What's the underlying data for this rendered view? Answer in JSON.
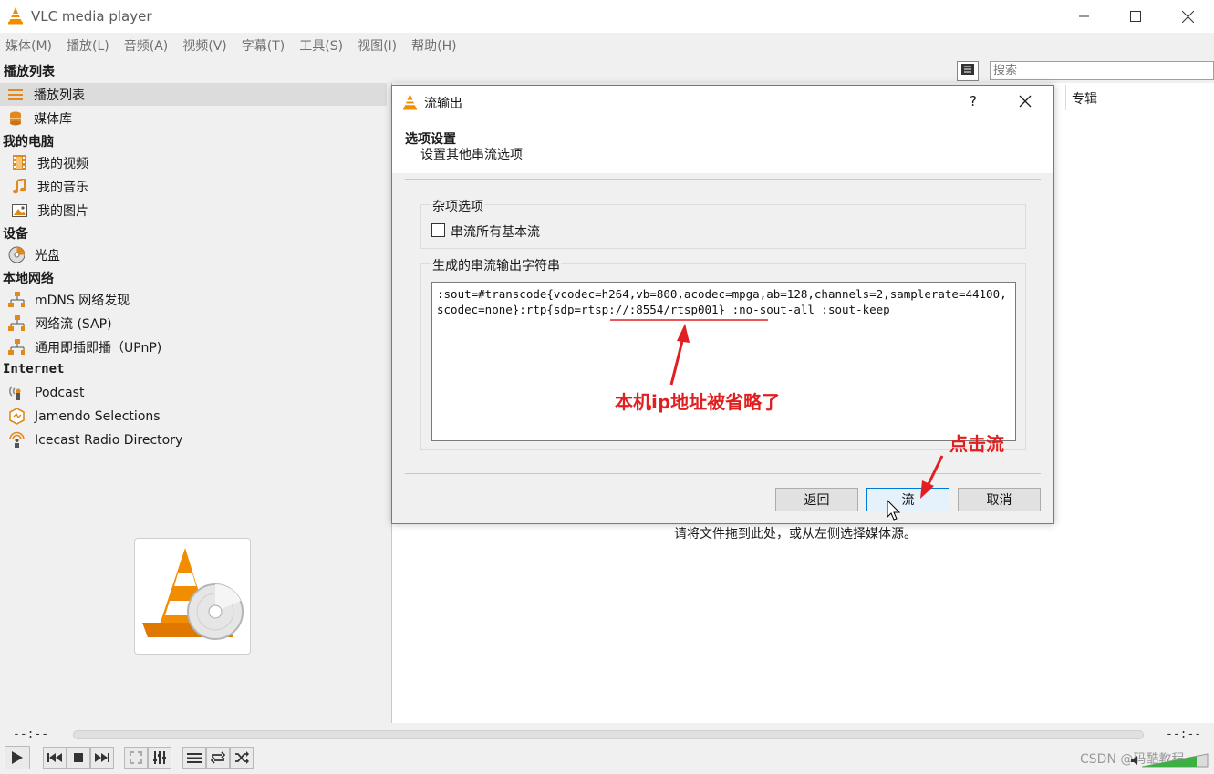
{
  "window": {
    "title": "VLC media player"
  },
  "menu": [
    "媒体(M)",
    "播放(L)",
    "音频(A)",
    "视频(V)",
    "字幕(T)",
    "工具(S)",
    "视图(I)",
    "帮助(H)"
  ],
  "playlist": {
    "header": "播放列表",
    "search_placeholder": "搜索",
    "column_album": "专辑",
    "drop_hint": "请将文件拖到此处，或从左侧选择媒体源。"
  },
  "sidebar": {
    "top_items": [
      {
        "label": "播放列表",
        "icon": "playlist-icon"
      },
      {
        "label": "媒体库",
        "icon": "media-library-icon"
      }
    ],
    "groups": [
      {
        "title": "我的电脑",
        "items": [
          {
            "label": "我的视频",
            "icon": "film-icon"
          },
          {
            "label": "我的音乐",
            "icon": "music-note-icon"
          },
          {
            "label": "我的图片",
            "icon": "picture-icon"
          }
        ]
      },
      {
        "title": "设备",
        "items": [
          {
            "label": "光盘",
            "icon": "disc-icon"
          }
        ]
      },
      {
        "title": "本地网络",
        "items": [
          {
            "label": "mDNS 网络发现",
            "icon": "network-icon"
          },
          {
            "label": "网络流 (SAP)",
            "icon": "network-icon"
          },
          {
            "label": "通用即插即播（UPnP)",
            "icon": "network-icon"
          }
        ]
      },
      {
        "title": "Internet",
        "items": [
          {
            "label": "Podcast",
            "icon": "podcast-icon"
          },
          {
            "label": "Jamendo Selections",
            "icon": "jamendo-icon"
          },
          {
            "label": "Icecast Radio Directory",
            "icon": "radio-icon"
          }
        ]
      }
    ]
  },
  "dialog": {
    "title": "流输出",
    "help": "?",
    "heading": "选项设置",
    "subheading": "设置其他串流选项",
    "misc_group": "杂项选项",
    "checkbox_label": "串流所有基本流",
    "checkbox_checked": false,
    "output_group": "生成的串流输出字符串",
    "output_string": ":sout=#transcode{vcodec=h264,vb=800,acodec=mpga,ab=128,channels=2,samplerate=44100,scodec=none}:rtp{sdp=rtsp://:8554/rtsp001} :no-sout-all :sout-keep",
    "buttons": {
      "back": "返回",
      "stream": "流",
      "cancel": "取消"
    }
  },
  "annotations": {
    "ip_note": "本机ip地址被省略了",
    "click_note": "点击流",
    "color": "#e02020"
  },
  "player": {
    "time_elapsed": "--:--",
    "time_total": "--:--"
  },
  "watermark": "CSDN @码酷教程",
  "colors": {
    "accent": "#0078d7",
    "vlc_orange": "#f28c00"
  }
}
